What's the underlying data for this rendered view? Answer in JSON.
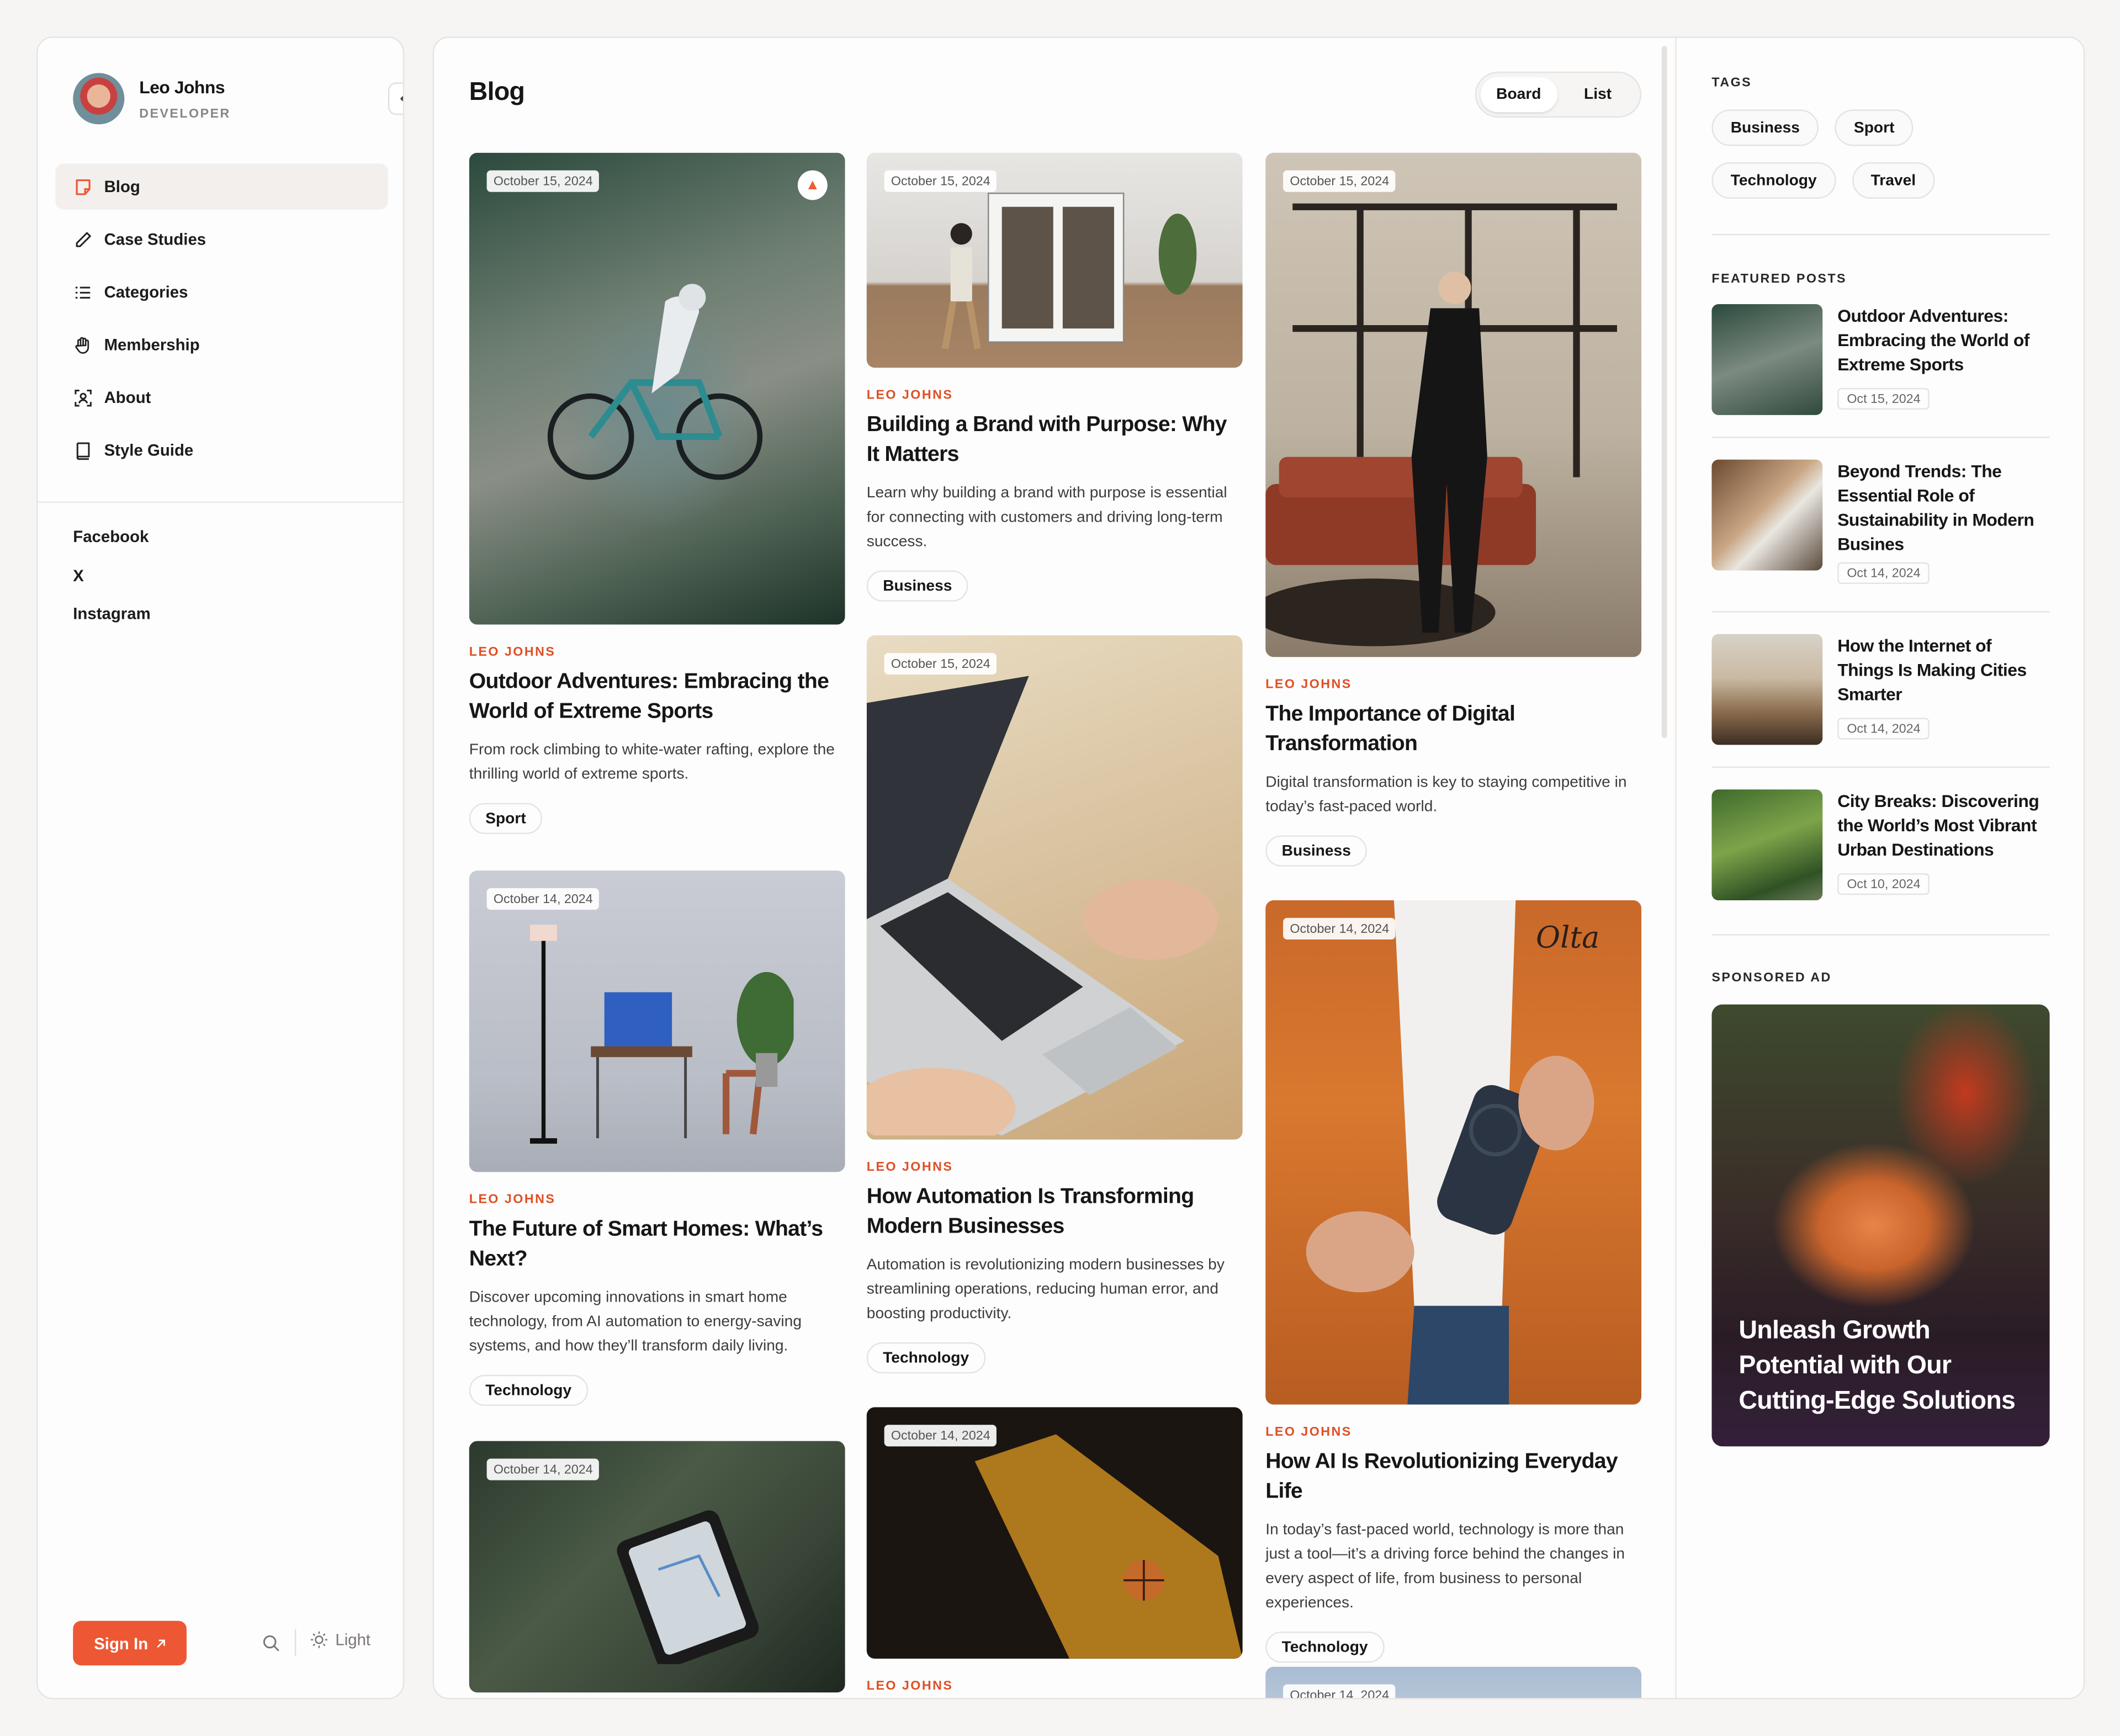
{
  "user": {
    "name": "Leo Johns",
    "role": "DEVELOPER"
  },
  "nav": [
    {
      "label": "Blog",
      "icon": "note-icon",
      "active": true
    },
    {
      "label": "Case Studies",
      "icon": "pencil-icon"
    },
    {
      "label": "Categories",
      "icon": "list-icon"
    },
    {
      "label": "Membership",
      "icon": "hand-icon"
    },
    {
      "label": "About",
      "icon": "person-scan-icon"
    },
    {
      "label": "Style Guide",
      "icon": "book-icon"
    }
  ],
  "social": [
    "Facebook",
    "X",
    "Instagram"
  ],
  "footer": {
    "signin": "Sign In",
    "theme": "Light"
  },
  "page": {
    "title": "Blog",
    "view_board": "Board",
    "view_list": "List"
  },
  "cards": [
    {
      "date": "October 15, 2024",
      "author": "LEO JOHNS",
      "title": "Outdoor Adventures: Embracing the World of Extreme Sports",
      "desc": "From rock climbing to white-water rafting, explore the thrilling world of extreme sports.",
      "tag": "Sport"
    },
    {
      "date": "October 14, 2024",
      "author": "LEO JOHNS",
      "title": "The Future of Smart Homes: What’s Next?",
      "desc": "Discover upcoming innovations in smart home technology, from AI automation to energy-saving systems, and how they’ll transform daily living.",
      "tag": "Technology"
    },
    {
      "date": "October 14, 2024"
    },
    {
      "date": "October 15, 2024",
      "author": "LEO JOHNS",
      "title": "Building a Brand with Purpose: Why It Matters",
      "desc": "Learn why building a brand with purpose is essential for connecting with customers and driving long-term success.",
      "tag": "Business"
    },
    {
      "date": "October 15, 2024",
      "author": "LEO JOHNS",
      "title": "How Automation Is Transforming Modern Businesses",
      "desc": "Automation is revolutionizing modern businesses by streamlining operations, reducing human error, and boosting productivity.",
      "tag": "Technology"
    },
    {
      "date": "October 14, 2024",
      "author": "LEO JOHNS"
    },
    {
      "date": "October 15, 2024",
      "author": "LEO JOHNS",
      "title": "The Importance of Digital Transformation",
      "desc": "Digital transformation is key to staying competitive in today’s fast-paced world.",
      "tag": "Business"
    },
    {
      "date": "October 14, 2024",
      "author": "LEO JOHNS",
      "title": "How AI Is Revolutionizing Everyday Life",
      "desc": "In today’s fast-paced world, technology is more than just a tool—it’s a driving force behind the changes in every aspect of life, from business to personal experiences.",
      "tag": "Technology"
    },
    {
      "date": "October 14, 2024"
    }
  ],
  "sidebar_right": {
    "tags_heading": "TAGS",
    "tags": [
      "Business",
      "Sport",
      "Technology",
      "Travel"
    ],
    "featured_heading": "FEATURED POSTS",
    "featured": [
      {
        "title": "Outdoor Adventures: Embracing the World of Extreme Sports",
        "date": "Oct 15, 2024"
      },
      {
        "title": "Beyond Trends: The Essential Role of Sustainability in Modern Busines",
        "date": "Oct 14, 2024"
      },
      {
        "title": "How the Internet of Things Is Making Cities Smarter",
        "date": "Oct 14, 2024"
      },
      {
        "title": "City Breaks: Discovering the World’s Most Vibrant Urban Destinations",
        "date": "Oct 10, 2024"
      }
    ],
    "ad_heading": "SPONSORED AD",
    "ad_text": "Unleash Growth Potential with Our Cutting-Edge Solutions"
  },
  "colors": {
    "accent": "#ed5734",
    "author": "#df4f24"
  }
}
